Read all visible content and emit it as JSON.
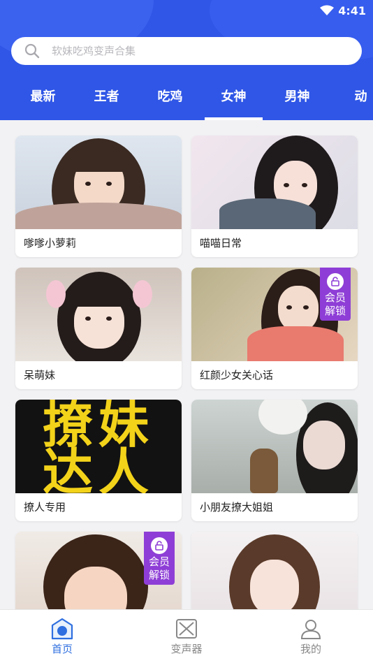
{
  "status": {
    "time": "4:41"
  },
  "search": {
    "placeholder": "软妹吃鸡变声合集"
  },
  "tabs": [
    {
      "label": "最新"
    },
    {
      "label": "王者"
    },
    {
      "label": "吃鸡"
    },
    {
      "label": "女神",
      "active": true
    },
    {
      "label": "男神"
    },
    {
      "label": "动"
    }
  ],
  "cards": [
    {
      "title": "嗲嗲小萝莉",
      "locked": false
    },
    {
      "title": "喵喵日常",
      "locked": false
    },
    {
      "title": "呆萌妹",
      "locked": false
    },
    {
      "title": "红颜少女关心话",
      "locked": true
    },
    {
      "title": "撩人专用",
      "locked": false,
      "image_text": "撩妹\n达人"
    },
    {
      "title": "小朋友撩大姐姐",
      "locked": false
    },
    {
      "title": "",
      "locked": true
    },
    {
      "title": "",
      "locked": false
    }
  ],
  "badge": {
    "line1": "会员",
    "line2": "解锁"
  },
  "bottom_nav": [
    {
      "label": "首页",
      "active": true
    },
    {
      "label": "变声器"
    },
    {
      "label": "我的"
    }
  ],
  "colors": {
    "header": "#2f56e6",
    "active_nav": "#2f6fe0",
    "badge": "#8e3ed6"
  }
}
